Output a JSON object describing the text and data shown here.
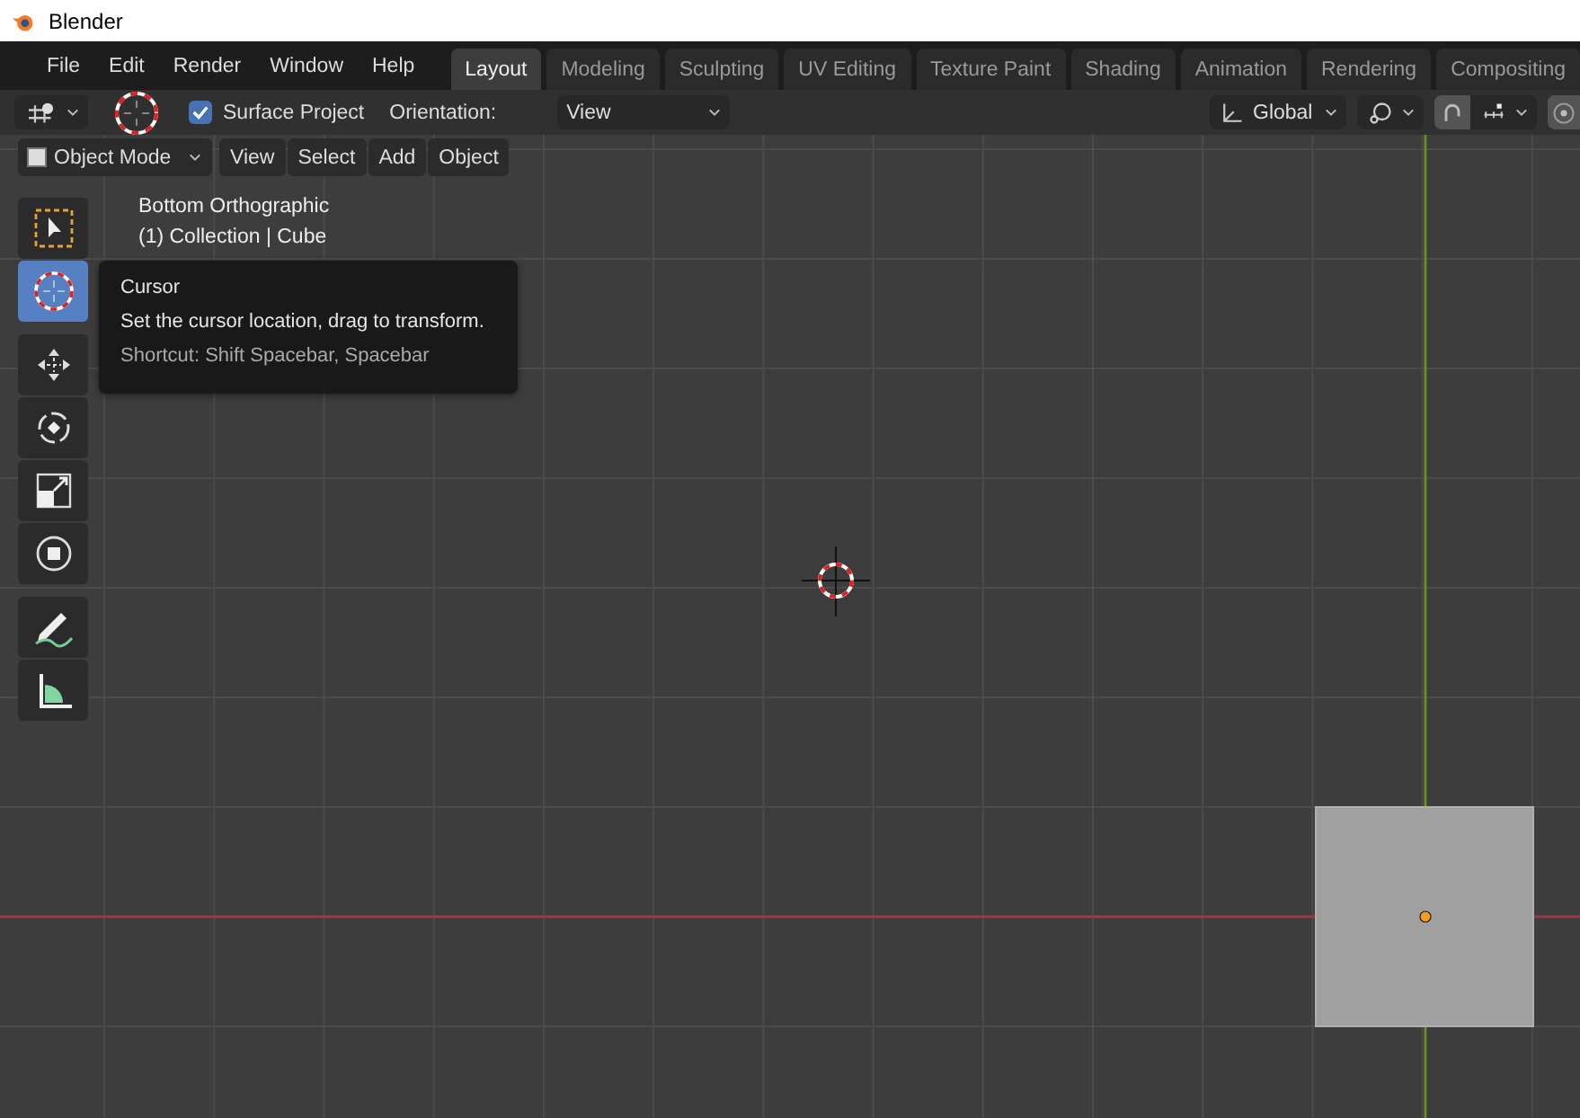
{
  "window": {
    "title": "Blender"
  },
  "menu": [
    "File",
    "Edit",
    "Render",
    "Window",
    "Help"
  ],
  "workspaces": [
    {
      "label": "Layout",
      "selected": true
    },
    {
      "label": "Modeling",
      "selected": false
    },
    {
      "label": "Sculpting",
      "selected": false
    },
    {
      "label": "UV Editing",
      "selected": false
    },
    {
      "label": "Texture Paint",
      "selected": false
    },
    {
      "label": "Shading",
      "selected": false
    },
    {
      "label": "Animation",
      "selected": false
    },
    {
      "label": "Rendering",
      "selected": false
    },
    {
      "label": "Compositing",
      "selected": false
    }
  ],
  "tool_settings": {
    "surface_project": {
      "label": "Surface Project",
      "checked": true
    },
    "orientation_label": "Orientation:",
    "orientation_value": "View",
    "transform_orientation": "Global"
  },
  "viewport_header": {
    "mode": "Object Mode",
    "menus": [
      "View",
      "Select",
      "Add",
      "Object"
    ]
  },
  "overlay_text": [
    "Bottom Orthographic",
    "(1) Collection | Cube"
  ],
  "tools": [
    {
      "kind": "select",
      "selected": false
    },
    {
      "kind": "cursor",
      "selected": true
    },
    {
      "kind": "move",
      "selected": false
    },
    {
      "kind": "rotate",
      "selected": false
    },
    {
      "kind": "scale",
      "selected": false
    },
    {
      "kind": "transform",
      "selected": false
    },
    {
      "kind": "annotate",
      "selected": false
    },
    {
      "kind": "measure",
      "selected": false
    }
  ],
  "tooltip": {
    "title": "Cursor",
    "description": "Set the cursor location, drag to transform.",
    "shortcut": "Shortcut: Shift Spacebar, Spacebar"
  }
}
